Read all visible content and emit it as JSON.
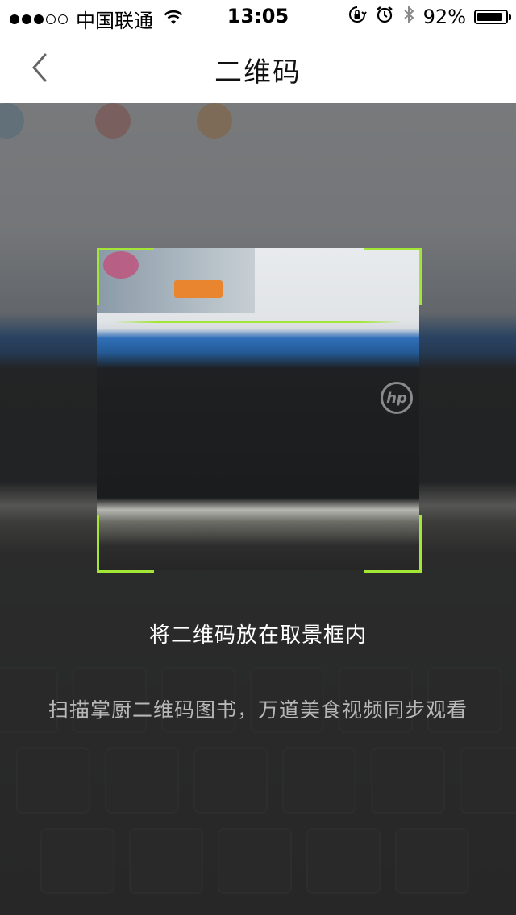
{
  "status_bar": {
    "carrier": "中国联通",
    "time": "13:05",
    "battery_percent": "92%",
    "battery_level": 0.92,
    "signal_strength": 3,
    "signal_max": 5
  },
  "nav": {
    "title": "二维码",
    "back_icon": "chevron-left-icon"
  },
  "scanner": {
    "frame_color": "#a3e635",
    "hint_primary": "将二维码放在取景框内",
    "hint_secondary": "扫描掌厨二维码图书，万道美食视频同步观看"
  }
}
